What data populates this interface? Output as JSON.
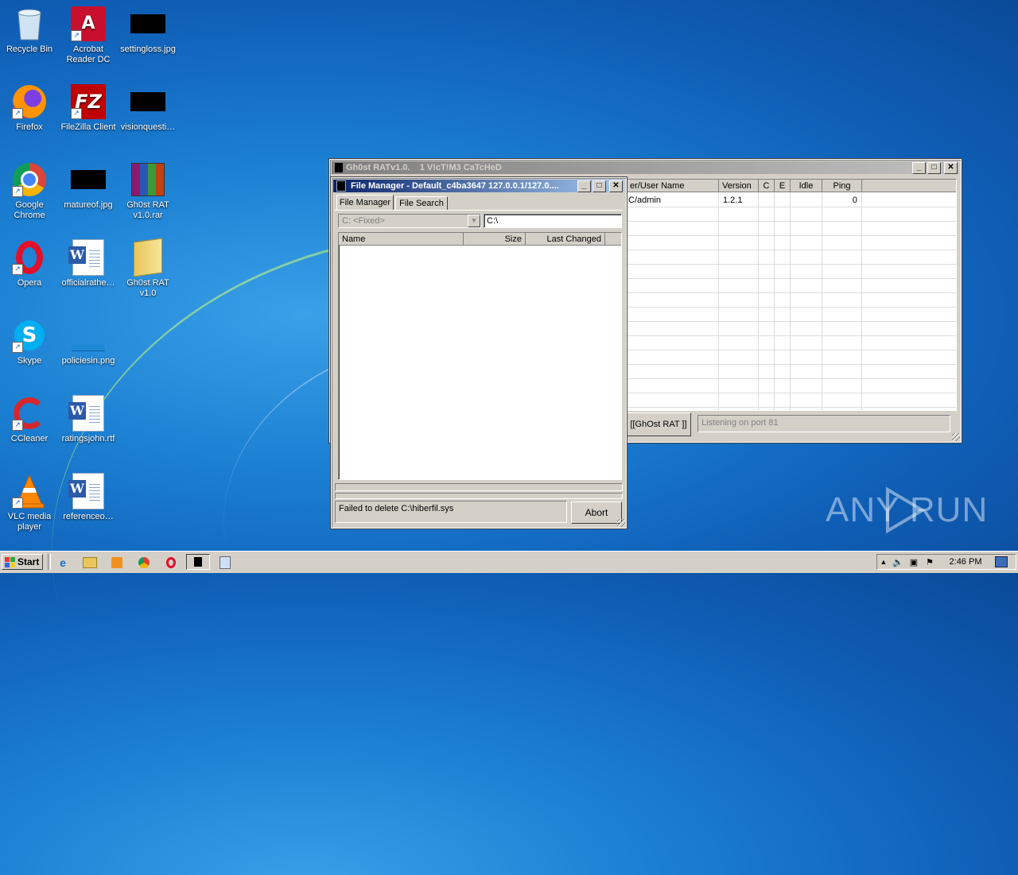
{
  "desktop": {
    "icons": [
      {
        "label": "Recycle Bin",
        "icon": "recycle-bin-icon"
      },
      {
        "label": "Acrobat Reader DC",
        "icon": "acrobat-icon"
      },
      {
        "label": "settingloss.jpg",
        "icon": "image-file-icon"
      },
      {
        "label": "Firefox",
        "icon": "firefox-icon"
      },
      {
        "label": "FileZilla Client",
        "icon": "filezilla-icon"
      },
      {
        "label": "visionquesti…",
        "icon": "image-file-icon"
      },
      {
        "label": "Google Chrome",
        "icon": "chrome-icon"
      },
      {
        "label": "matureof.jpg",
        "icon": "image-file-icon"
      },
      {
        "label": "Gh0st RAT v1.0.rar",
        "icon": "winrar-icon"
      },
      {
        "label": "Opera",
        "icon": "opera-icon"
      },
      {
        "label": "officialrathe…",
        "icon": "word-doc-icon"
      },
      {
        "label": "Gh0st RAT v1.0",
        "icon": "folder-icon"
      },
      {
        "label": "Skype",
        "icon": "skype-icon"
      },
      {
        "label": "policiesin.png",
        "icon": "image-file-icon"
      },
      {
        "label": "CCleaner",
        "icon": "ccleaner-icon"
      },
      {
        "label": "ratingsjohn.rtf",
        "icon": "word-doc-icon"
      },
      {
        "label": "VLC media player",
        "icon": "vlc-icon"
      },
      {
        "label": "referenceo…",
        "icon": "word-doc-icon"
      }
    ]
  },
  "rat_window": {
    "title": "Gh0st RATv1.0.",
    "subtitle": "1 V!cT!M3 CaTcHeD",
    "columns": [
      "er/User Name",
      "Version",
      "C",
      "E",
      "Idle",
      "Ping"
    ],
    "rows": [
      {
        "user": "C/admin",
        "version": "1.2.1",
        "c": "",
        "e": "",
        "idle": "",
        "ping": "0"
      }
    ],
    "tag_button": "[[GhOst RAT ]]",
    "status": "Listening on port 81"
  },
  "file_manager": {
    "title": "File Manager - Default_c4ba3647 127.0.0.1/127.0....",
    "tabs": [
      "File Manager",
      "File Search"
    ],
    "drive_select": "C: <Fixed>",
    "path": "C:\\",
    "columns": [
      "Name",
      "Size",
      "Last Changed"
    ],
    "status_text": "Failed to delete C:\\hiberfil.sys",
    "abort_label": "Abort"
  },
  "taskbar": {
    "start_label": "Start",
    "clock": "2:46 PM"
  },
  "watermark": "ANY RUN"
}
